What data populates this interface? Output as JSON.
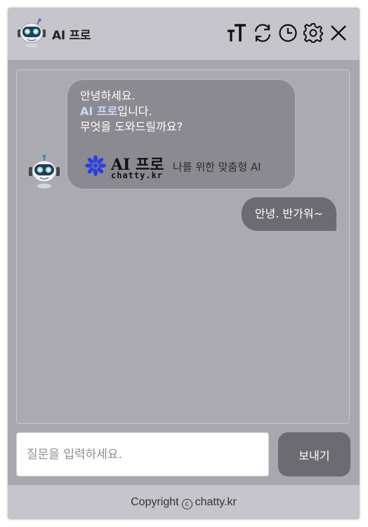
{
  "header": {
    "title": "AI 프로",
    "icons": [
      "robot-logo-icon",
      "font-size-icon",
      "refresh-icon",
      "history-clock-icon",
      "settings-gear-icon",
      "close-icon"
    ]
  },
  "chat": {
    "bot_message": {
      "line1": "안녕하세요.",
      "line2_highlight": "AI 프로",
      "line2_rest": "입니다.",
      "line3": "무엇을 도와드릴까요?",
      "brand_logo_main": "AI 프로",
      "brand_logo_sub": "chatty.kr",
      "brand_tagline": "나를 위한 맞춤형 AI"
    },
    "user_message": "안녕. 반가워~"
  },
  "input": {
    "placeholder": "질문을 입력하세요.",
    "value": "",
    "send_label": "보내기"
  },
  "footer": {
    "copyright_prefix": "Copyright",
    "copyright_symbol": "c",
    "site": "chatty.kr"
  },
  "colors": {
    "header_bg": "#c6c5cb",
    "panel_bg": "#abaab0",
    "bot_bubble": "#8b8a90",
    "user_bubble": "#6c6b71",
    "highlight": "#ccd6ff",
    "brand_blue": "#2b3fe0"
  }
}
